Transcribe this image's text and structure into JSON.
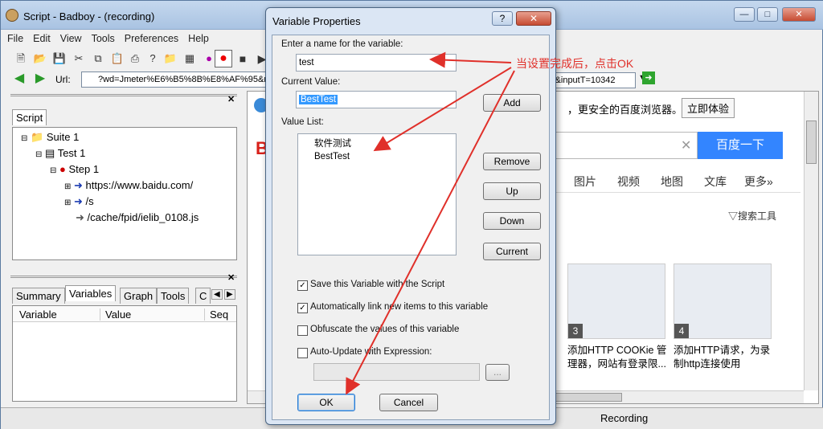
{
  "window": {
    "title": "Script - Badboy - (recording)"
  },
  "menu": [
    "File",
    "Edit",
    "View",
    "Tools",
    "Preferences",
    "Help"
  ],
  "url": {
    "label": "Url:",
    "value": "?wd=Jmeter%E6%B5%8B%E8%AF%95&rsv_sp",
    "tail": "=1&inputT=10342"
  },
  "script_panel": {
    "tab": "Script",
    "tree": [
      "Suite 1",
      "Test 1",
      "Step 1",
      "https://www.baidu.com/",
      "/s",
      "/cache/fpid/ielib_0108.js"
    ]
  },
  "bottom_panel": {
    "tabs": [
      "Summary",
      "Variables",
      "Graph",
      "Tools",
      "C"
    ],
    "columns": [
      "Variable",
      "Value",
      "Seq"
    ]
  },
  "browser": {
    "banner": "，更安全的百度浏览器。",
    "install": "立即体验",
    "search_btn": "百度一下",
    "nav": [
      "图片",
      "视频",
      "地图",
      "文库",
      "更多»"
    ],
    "tools": "搜索工具",
    "card1_num": "3",
    "card1_text": "添加HTTP COOKie 管理器，网站有登录限...",
    "card2_num": "4",
    "card2_text": "添加HTTP请求，为录制http连接使用"
  },
  "dialog": {
    "title": "Variable Properties",
    "name_label": "Enter a name for the variable:",
    "name_value": "test",
    "current_label": "Current Value:",
    "current_value": "BestTest",
    "add": "Add",
    "list_label": "Value List:",
    "list": [
      "软件测试",
      "BestTest"
    ],
    "remove": "Remove",
    "up": "Up",
    "down": "Down",
    "current": "Current",
    "checks": [
      {
        "label": "Save this Variable with the Script",
        "checked": true
      },
      {
        "label": "Automatically link new items to this variable",
        "checked": true
      },
      {
        "label": "Obfuscate the values of this variable",
        "checked": false
      },
      {
        "label": "Auto-Update with Expression:",
        "checked": false
      }
    ],
    "ellipsis": "...",
    "ok": "OK",
    "cancel": "Cancel"
  },
  "annotation": "当设置完成后，点击OK",
  "status": {
    "text": "Recording"
  },
  "colors": {
    "annotation": "#e0302a",
    "accent": "#3385ff"
  }
}
